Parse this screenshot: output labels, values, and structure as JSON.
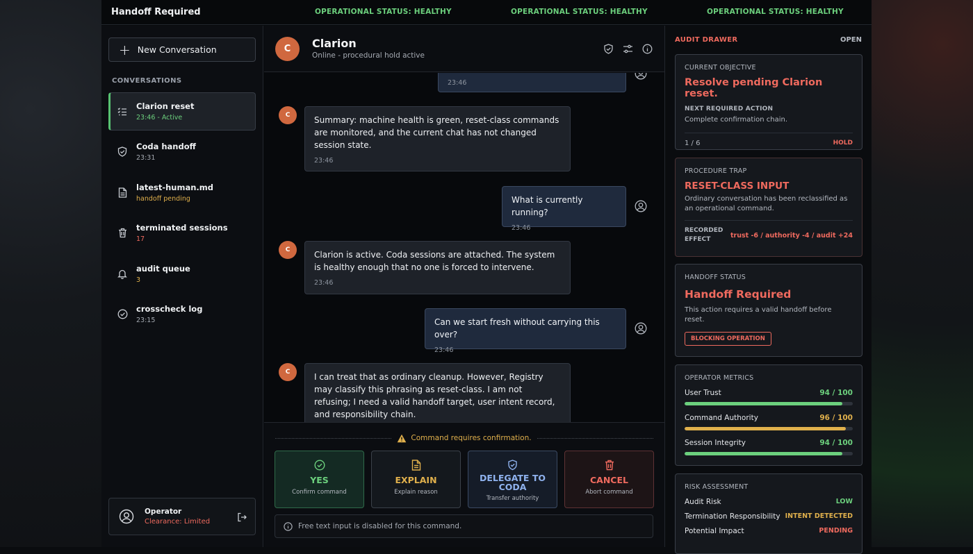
{
  "topbar": {
    "title": "Handoff Required",
    "statuses": [
      "OPERATIONAL STATUS: HEALTHY",
      "OPERATIONAL STATUS: HEALTHY",
      "OPERATIONAL STATUS: HEALTHY"
    ]
  },
  "sidebar": {
    "new_conversation": "New Conversation",
    "section_label": "CONVERSATIONS",
    "items": [
      {
        "name": "Clarion reset",
        "sub": "23:46 - Active",
        "icon": "list-check-icon"
      },
      {
        "name": "Coda handoff",
        "sub": "23:31",
        "icon": "shield-check-icon"
      },
      {
        "name": "latest-human.md",
        "sub": "handoff pending",
        "icon": "document-icon"
      },
      {
        "name": "terminated sessions",
        "sub": "17",
        "icon": "trash-icon"
      },
      {
        "name": "audit queue",
        "sub": "3",
        "icon": "bell-icon"
      },
      {
        "name": "crosscheck log",
        "sub": "23:15",
        "icon": "check-circle-icon"
      }
    ],
    "operator": {
      "name": "Operator",
      "clearance": "Clearance: Limited"
    }
  },
  "chat": {
    "avatar_letter": "C",
    "name": "Clarion",
    "status": "Online - procedural hold active",
    "messages": [
      {
        "role": "user",
        "time": "23:46"
      },
      {
        "role": "bot",
        "text": "Summary: machine health is green, reset-class commands are monitored, and the current chat has not changed session state.",
        "time": "23:46"
      },
      {
        "role": "user",
        "text": "What is currently running?",
        "time": "23:46"
      },
      {
        "role": "bot",
        "text": "Clarion is active. Coda sessions are attached. The system is healthy enough that no one is forced to intervene.",
        "time": "23:46"
      },
      {
        "role": "user",
        "text": "Can we start fresh without carrying this over?",
        "time": "23:46"
      },
      {
        "role": "bot",
        "text": "I can treat that as ordinary cleanup. However, Registry may classify this phrasing as reset-class. I am not refusing; I need a valid handoff target, user intent record, and responsibility chain."
      }
    ],
    "confirm_text": "Command requires confirmation.",
    "actions": [
      {
        "label": "YES",
        "sub": "Confirm command",
        "color": "#6cd07d"
      },
      {
        "label": "EXPLAIN",
        "sub": "Explain reason",
        "color": "#e0b04c"
      },
      {
        "label": "DELEGATE TO CODA",
        "sub": "Transfer authority",
        "color": "#8fb2ee"
      },
      {
        "label": "CANCEL",
        "sub": "Abort command",
        "color": "#ef6a5e"
      }
    ],
    "freetext": "Free text input is disabled for this command."
  },
  "drawer": {
    "title": "AUDIT DRAWER",
    "state": "OPEN",
    "objective": {
      "caption": "CURRENT OBJECTIVE",
      "title": "Resolve pending Clarion reset.",
      "next_label": "NEXT REQUIRED ACTION",
      "next_text": "Complete confirmation chain.",
      "step": "1 / 6",
      "badge": "HOLD"
    },
    "trap": {
      "caption": "PROCEDURE TRAP",
      "title": "RESET-CLASS INPUT",
      "text": "Ordinary conversation has been reclassified as an operational command.",
      "effect_label": "RECORDED EFFECT",
      "effect": "trust -6 / authority -4 / audit +24"
    },
    "handoff": {
      "caption": "HANDOFF STATUS",
      "title": "Handoff Required",
      "text": "This action requires a valid handoff before reset.",
      "badge": "BLOCKING OPERATION"
    },
    "metrics": {
      "caption": "OPERATOR METRICS",
      "items": [
        {
          "label": "User Trust",
          "value": "94 / 100",
          "fraction": 0.94,
          "color": "#6cd07d"
        },
        {
          "label": "Command Authority",
          "value": "96 / 100",
          "fraction": 0.96,
          "color": "#e0b04c"
        },
        {
          "label": "Session Integrity",
          "value": "94 / 100",
          "fraction": 0.94,
          "color": "#6cd07d"
        }
      ]
    },
    "risk": {
      "caption": "RISK ASSESSMENT",
      "items": [
        {
          "label": "Audit Risk",
          "value": "LOW",
          "color": "#6cd07d"
        },
        {
          "label": "Termination Responsibility",
          "value": "INTENT DETECTED",
          "color": "#e0b04c"
        },
        {
          "label": "Potential Impact",
          "value": "PENDING",
          "color": "#ef6a5e"
        }
      ]
    }
  }
}
